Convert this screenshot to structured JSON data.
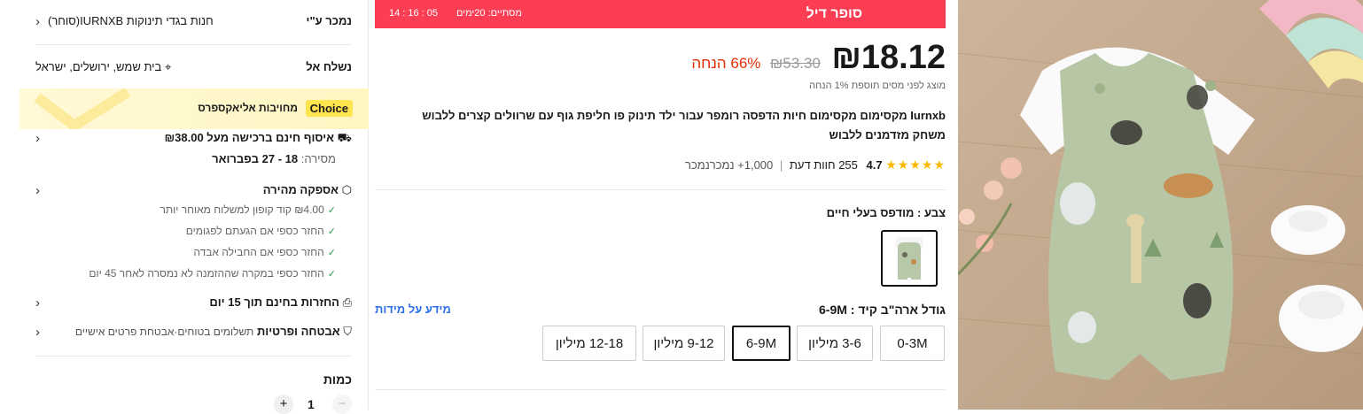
{
  "left_panel": {
    "seller_label": "נמכר ע\"י",
    "seller_name": "חנות בגדי תינוקות IURNXB(סוחר)",
    "ship_to_label": "נשלח אל",
    "ship_to_value": "בית שמש, ירושלים, ישראל",
    "choice_badge": "Choice",
    "choice_text": "מחויבות אליאקספרס",
    "free_pickup": "איסוף חינם ברכישה מעל ₪38.00",
    "delivery_label": "מסירה:",
    "delivery_dates": "18 - 27 בפברואר",
    "fast_delivery": "אספקה מהירה",
    "benefits": [
      "₪4.00 קוד קופון למשלוח מאוחר יותר",
      "החזר כספי אם הגעתם לפגומים",
      "החזר כספי אם החבילה אבדה",
      "החזר כספי במקרה שההזמנה לא נמסרה לאחר 45 יום"
    ],
    "returns": "החזרות בחינם תוך 15 יום",
    "security_title": "אבטחה ופרטיות",
    "security_text": "תשלומים בטוחים·אבטחת פרטים אישיים",
    "quantity_label": "כמות",
    "quantity_value": "1",
    "plus": "+",
    "minus": "−"
  },
  "deal": {
    "title": "סופר דיל",
    "ends_label": "מסתיים: 20ימים",
    "timer": "14 : 16 : 05"
  },
  "price": {
    "current": "₪18.12",
    "original": "₪53.30",
    "discount": "66% הנחה",
    "tax_note": "מוצג לפני מסים תוספת 1% הנחה"
  },
  "product": {
    "title": "Iurnxb מקסימום מקסימום חיות הדפסה רומפר עבור ילד תינוק פו חליפת גוף עם שרוולים קצרים ללבוש משחק מזדמנים ללבוש",
    "rating": "4.7",
    "reviews": "255 חוות דעת",
    "sold": "1,000+ נמכרנמכר",
    "color_label": "צבע : מודפס בעלי חיים",
    "size_label": "גודל ארה\"ב קיד : 6-9M",
    "size_info": "מידע על מידות",
    "sizes": [
      "0-3M",
      "3-6 מיליון",
      "6-9M",
      "9-12 מיליון",
      "12-18 מיליון"
    ],
    "selected_size": "6-9M"
  },
  "colors": {
    "accent": "#fc3e55",
    "price_red": "#e62e04",
    "choice_yellow": "#ffe34f",
    "link_blue": "#2e6ee6",
    "star": "#fdb900"
  }
}
